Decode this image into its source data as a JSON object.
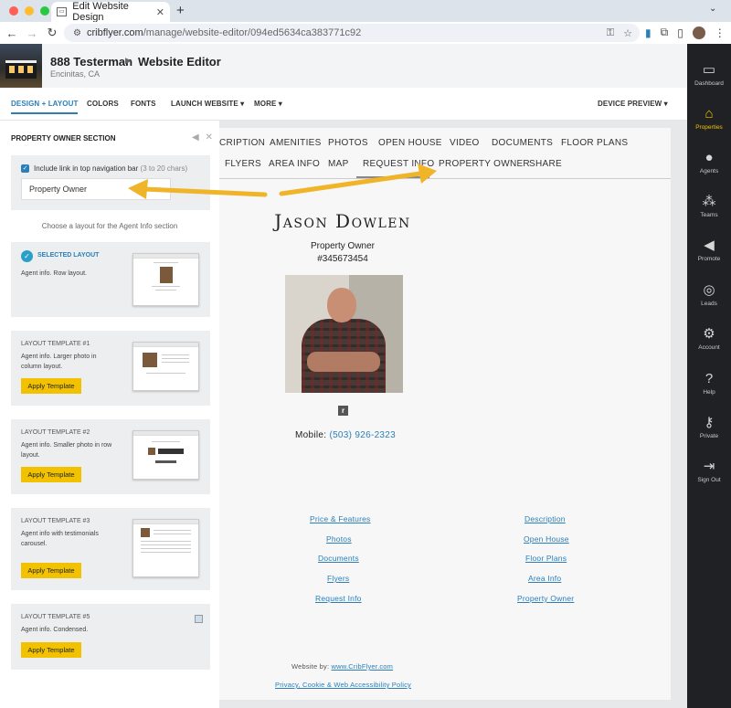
{
  "browser": {
    "tab_title": "Edit Website Design",
    "url_host": "cribflyer.com",
    "url_path": "/manage/website-editor/094ed5634ca383771c92"
  },
  "header": {
    "property_title": "888 Testerman",
    "editor_title": "Website Editor",
    "location": "Encinitas, CA"
  },
  "toolbar": {
    "design_layout": "DESIGN + LAYOUT",
    "colors": "COLORS",
    "fonts": "FONTS",
    "launch": "LAUNCH WEBSITE",
    "more": "MORE",
    "device_preview": "DEVICE PREVIEW"
  },
  "panel": {
    "title": "PROPERTY OWNER SECTION",
    "checkbox_label": "Include link in top navigation bar",
    "checkbox_hint": "(3 to 20 chars)",
    "name_value": "Property Owner",
    "choose_text": "Choose a layout for the Agent Info section",
    "apply_label": "Apply Template",
    "layouts": [
      {
        "title": "SELECTED LAYOUT",
        "desc": "Agent info. Row layout."
      },
      {
        "title": "LAYOUT TEMPLATE #1",
        "desc": "Agent info. Larger photo in column layout."
      },
      {
        "title": "LAYOUT TEMPLATE #2",
        "desc": "Agent info. Smaller photo in row layout."
      },
      {
        "title": "LAYOUT TEMPLATE #3",
        "desc": "Agent info with testimonials carousel."
      },
      {
        "title": "LAYOUT TEMPLATE #5",
        "desc": "Agent info. Condensed."
      }
    ]
  },
  "preview": {
    "nav_row1": [
      "CRIPTION",
      "AMENITIES",
      "PHOTOS",
      "OPEN HOUSE",
      "VIDEO",
      "DOCUMENTS",
      "FLOOR PLANS"
    ],
    "nav_row2": [
      "FLYERS",
      "AREA INFO",
      "MAP",
      "REQUEST INFO",
      "PROPERTY OWNER",
      "SHARE"
    ],
    "agent_name": "Jason Dowlen",
    "agent_title": "Property Owner",
    "agent_id": "#345673454",
    "brand_letter": "r",
    "mobile_label": "Mobile:",
    "mobile_number": "(503) 926-2323",
    "footer_left": [
      "Price & Features",
      "Photos",
      "Documents",
      "Flyers",
      "Request Info"
    ],
    "footer_right": [
      "Description",
      "Open House",
      "Floor Plans",
      "Area Info",
      "Property Owner"
    ],
    "website_by": "Website by:",
    "website_link": "www.CribFlyer.com",
    "policy_link": "Privacy, Cookie & Web Accessibility Policy"
  },
  "sidebar": {
    "items": [
      "Dashboard",
      "Properties",
      "Agents",
      "Teams",
      "Promote",
      "Leads",
      "Account",
      "Help",
      "Private",
      "Sign Out"
    ]
  },
  "colors": {
    "accent_blue": "#2a7fb8",
    "accent_yellow": "#f2c200",
    "arrow_color": "#f0b428",
    "sidebar_bg": "#1f2124"
  }
}
